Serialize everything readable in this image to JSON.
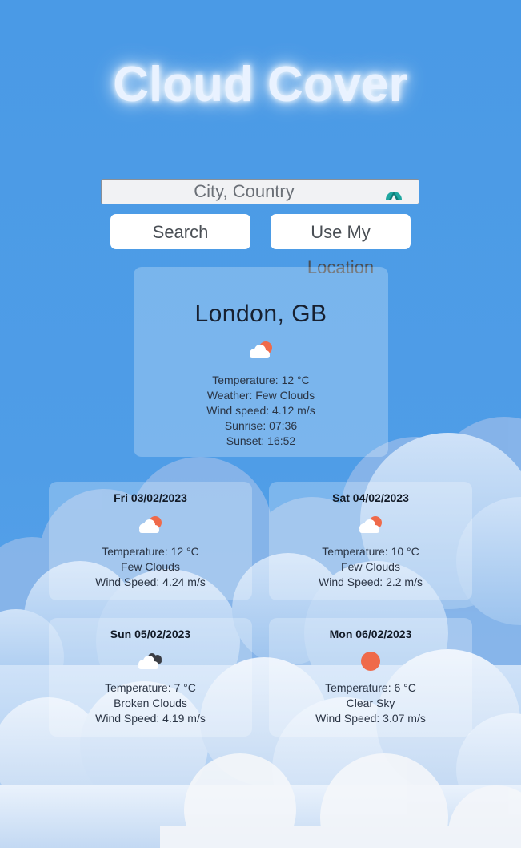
{
  "app": {
    "title": "Cloud Cover"
  },
  "search": {
    "placeholder": "City, Country"
  },
  "buttons": {
    "search_label": "Search",
    "location_label": "Use My Location"
  },
  "current": {
    "city": "London, GB",
    "icon": "few-clouds-day-icon",
    "temperature": "Temperature: 12 °C",
    "weather": "Weather: Few Clouds",
    "wind": "Wind speed: 4.12 m/s",
    "sunrise": "Sunrise: 07:36",
    "sunset": "Sunset: 16:52"
  },
  "forecast": [
    {
      "date": "Fri 03/02/2023",
      "icon": "few-clouds-day-icon",
      "temperature": "Temperature: 12 °C",
      "condition": "Few Clouds",
      "wind": "Wind Speed: 4.24 m/s"
    },
    {
      "date": "Sat 04/02/2023",
      "icon": "few-clouds-day-icon",
      "temperature": "Temperature: 10 °C",
      "condition": "Few Clouds",
      "wind": "Wind Speed: 2.2 m/s"
    },
    {
      "date": "Sun 05/02/2023",
      "icon": "broken-clouds-icon",
      "temperature": "Temperature: 7 °C",
      "condition": "Broken Clouds",
      "wind": "Wind Speed: 4.19 m/s"
    },
    {
      "date": "Mon 06/02/2023",
      "icon": "clear-sky-sun-icon",
      "temperature": "Temperature: 6 °C",
      "condition": "Clear Sky",
      "wind": "Wind Speed: 3.07 m/s"
    }
  ],
  "colors": {
    "sky": "#4a9ae6",
    "sun": "#ef6a4a",
    "title_glow": "#ffffff"
  }
}
